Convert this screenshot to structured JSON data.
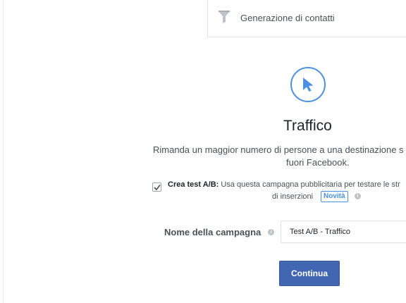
{
  "objective_option": {
    "label": "Generazione di contatti",
    "icon": "funnel-icon"
  },
  "selected_objective": {
    "icon": "cursor-icon",
    "title": "Traffico",
    "description_line1": "Rimanda un maggior numero di persone a una destinazione s",
    "description_line2": "fuori Facebook."
  },
  "ab_test": {
    "checked": true,
    "label": "Crea test A/B:",
    "text_line1": "Usa questa campagna pubblicitaria per testare le str",
    "text_line2": "di inserzioni",
    "badge": "Novità"
  },
  "campaign_name": {
    "label": "Nome della campagna",
    "value": "Test A/B - Traffico"
  },
  "continue_label": "Continua",
  "colors": {
    "accent": "#4a90e2",
    "button": "#4267b2",
    "text": "#4b4f56"
  }
}
